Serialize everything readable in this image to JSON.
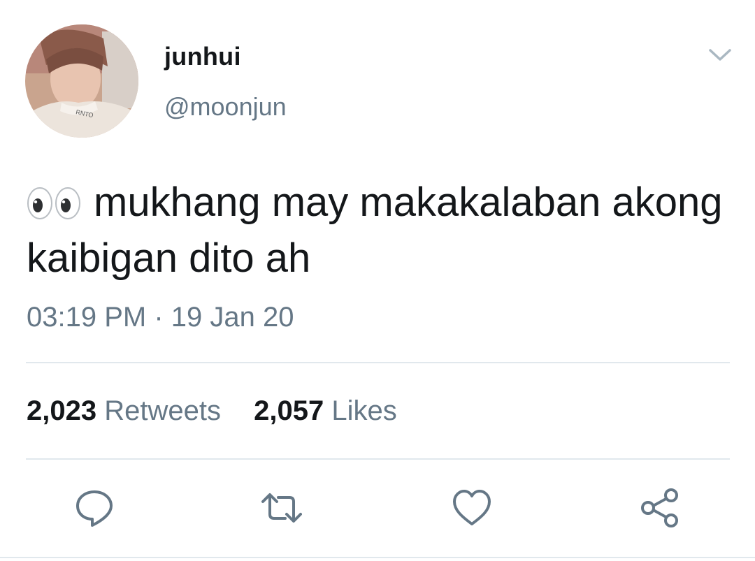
{
  "tweet": {
    "author": {
      "display_name": "junhui",
      "handle": "@moonjun"
    },
    "emoji_icon": "eyes-emoji",
    "text": "mukhang may makakalaban akong kaibigan dito ah",
    "time": "03:19 PM",
    "separator": "·",
    "date": "19 Jan 20",
    "stats": {
      "retweets_count": "2,023",
      "retweets_label": "Retweets",
      "likes_count": "2,057",
      "likes_label": "Likes"
    }
  },
  "actions": {
    "icons": [
      "reply-icon",
      "retweet-icon",
      "like-icon",
      "share-icon"
    ]
  },
  "colors": {
    "text_primary": "#14171a",
    "text_secondary": "#657786",
    "icon": "#657786",
    "divider": "#e1e8ed"
  }
}
